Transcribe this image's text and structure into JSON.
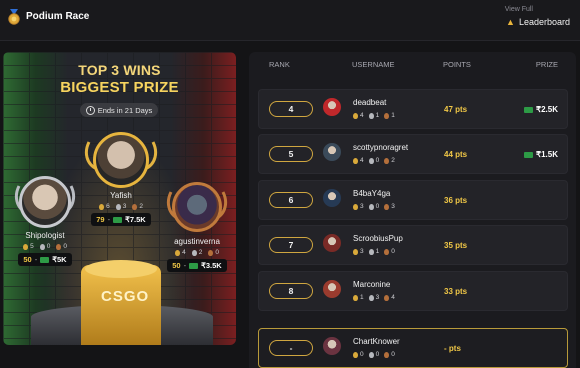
{
  "header": {
    "title": "Podium Race",
    "view_full": "View Full",
    "leaderboard_link": "Leaderboard"
  },
  "podium": {
    "title_line1": "TOP 3 WINS",
    "title_line2": "BIGGEST PRIZE",
    "ends": "Ends in 21 Days",
    "logo_text": "CSGO",
    "players": [
      {
        "name": "Shipologist",
        "gold": "5",
        "silver": "0",
        "bronze": "0",
        "points": "50",
        "prize": "₹5K",
        "tier": "silver"
      },
      {
        "name": "Yafish",
        "gold": "6",
        "silver": "3",
        "bronze": "2",
        "points": "79",
        "prize": "₹7.5K",
        "tier": "gold"
      },
      {
        "name": "agustinverna",
        "gold": "4",
        "silver": "2",
        "bronze": "0",
        "points": "50",
        "prize": "₹3.5K",
        "tier": "bronze"
      }
    ]
  },
  "table": {
    "headers": {
      "rank": "RANK",
      "username": "USERNAME",
      "points": "POINTS",
      "prize": "PRIZE"
    },
    "rows": [
      {
        "rank": "4",
        "username": "deadbeat",
        "gold": "4",
        "silver": "1",
        "bronze": "1",
        "points": "47 pts",
        "prize": "₹2.5K",
        "avatar_color": "#c0282b"
      },
      {
        "rank": "5",
        "username": "scottypnoragret",
        "gold": "4",
        "silver": "0",
        "bronze": "2",
        "points": "44 pts",
        "prize": "₹1.5K",
        "avatar_color": "#3a4a5a"
      },
      {
        "rank": "6",
        "username": "B4baY4ga",
        "gold": "3",
        "silver": "0",
        "bronze": "3",
        "points": "36 pts",
        "prize": "",
        "avatar_color": "#263a55"
      },
      {
        "rank": "7",
        "username": "ScroobiusPup",
        "gold": "3",
        "silver": "1",
        "bronze": "0",
        "points": "35 pts",
        "prize": "",
        "avatar_color": "#7a2a26"
      },
      {
        "rank": "8",
        "username": "Marconine",
        "gold": "1",
        "silver": "3",
        "bronze": "4",
        "points": "33 pts",
        "prize": "",
        "avatar_color": "#9a3b2e"
      }
    ],
    "current_user": {
      "rank": "-",
      "username": "ChartKnower",
      "gold": "0",
      "silver": "0",
      "bronze": "0",
      "points": "- pts",
      "avatar_color": "#6b3340"
    }
  },
  "colors": {
    "accent_gold": "#f1c847",
    "cash_green": "#2d9b46",
    "row_bg": "#232328"
  }
}
